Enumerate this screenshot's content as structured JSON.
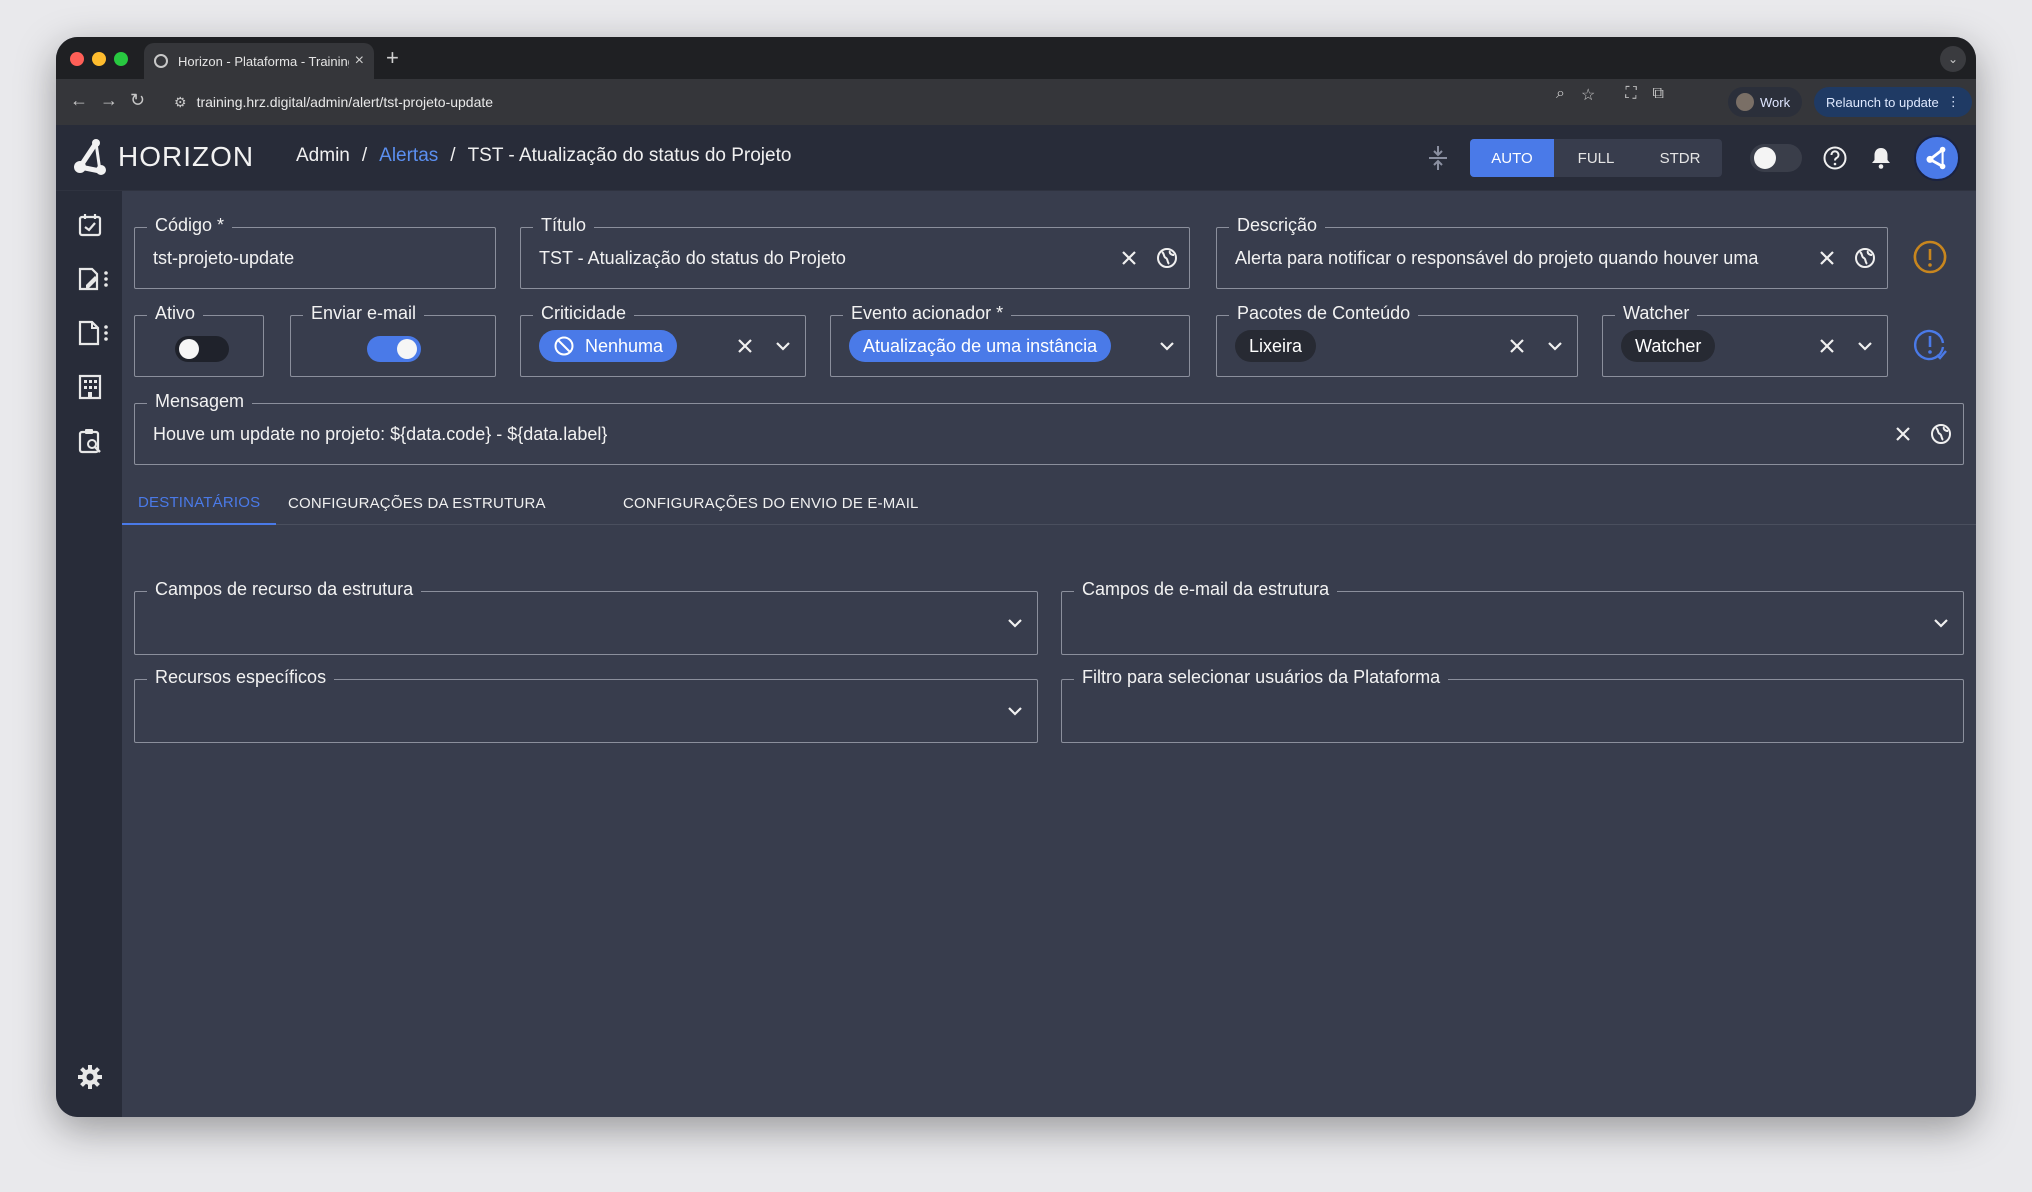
{
  "browser": {
    "tab_title": "Horizon - Plataforma - Training",
    "url": "training.hrz.digital/admin/alert/tst-projeto-update",
    "profile_label": "Work",
    "relaunch_label": "Relaunch to update"
  },
  "header": {
    "logo_text": "HORIZON",
    "breadcrumb": {
      "root": "Admin",
      "section": "Alertas",
      "current": "TST - Atualização do status do Projeto"
    },
    "modes": [
      "AUTO",
      "FULL",
      "STDR"
    ],
    "active_mode": "AUTO"
  },
  "form": {
    "codigo": {
      "label": "Código *",
      "value": "tst-projeto-update"
    },
    "titulo": {
      "label": "Título",
      "value": "TST - Atualização do status do Projeto"
    },
    "descricao": {
      "label": "Descrição",
      "value": "Alerta para notificar o responsável do projeto quando houver uma"
    },
    "ativo": {
      "label": "Ativo",
      "checked": false
    },
    "enviar_email": {
      "label": "Enviar e-mail",
      "checked": true
    },
    "criticidade": {
      "label": "Criticidade",
      "value": "Nenhuma"
    },
    "evento": {
      "label": "Evento acionador *",
      "value": "Atualização de uma instância"
    },
    "pacotes": {
      "label": "Pacotes de Conteúdo",
      "value": "Lixeira"
    },
    "watcher": {
      "label": "Watcher",
      "value": "Watcher"
    },
    "mensagem": {
      "label": "Mensagem",
      "value": "Houve um update no projeto: ${data.code} - ${data.label}"
    }
  },
  "tabs": [
    "DESTINATÁRIOS",
    "CONFIGURAÇÕES DA ESTRUTURA",
    "CONFIGURAÇÕES DO ENVIO DE E-MAIL"
  ],
  "recipients": {
    "campos_recurso": {
      "label": "Campos de recurso da estrutura",
      "value": ""
    },
    "campos_email": {
      "label": "Campos de e-mail da estrutura",
      "value": ""
    },
    "recursos_especificos": {
      "label": "Recursos específicos",
      "value": ""
    },
    "filtro_usuarios": {
      "label": "Filtro para selecionar usuários da Plataforma",
      "value": ""
    }
  },
  "colors": {
    "accent": "#4a7ae8",
    "background": "#383d4d",
    "header": "#282c39",
    "warning": "#c8861e"
  }
}
